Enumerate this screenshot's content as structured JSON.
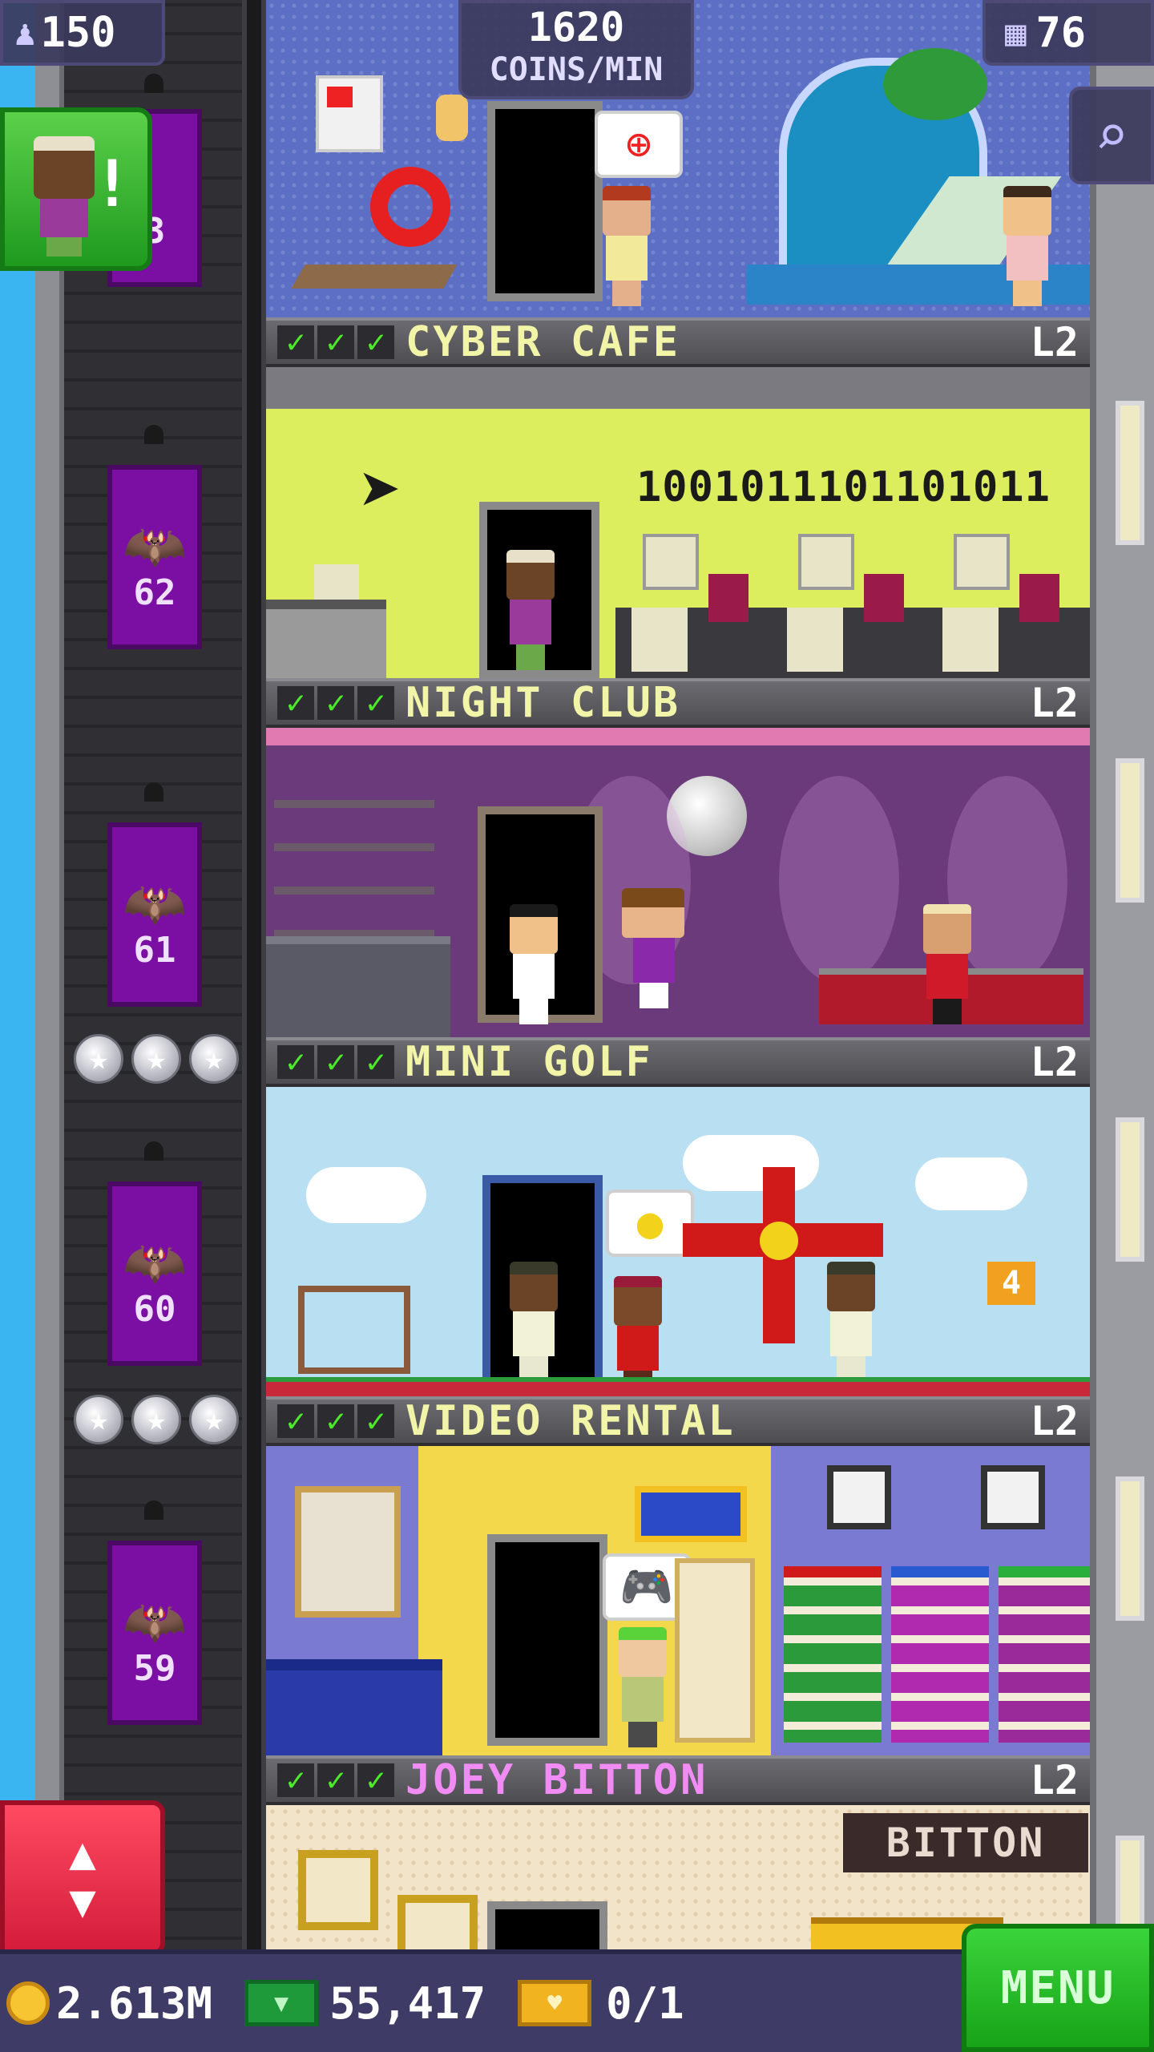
{
  "hud": {
    "population": "150",
    "coins_per_min_value": "1620",
    "coins_per_min_label": "COINS/MIN",
    "floors_count": "76"
  },
  "floors": [
    {
      "name": "CYBER CAFE",
      "level": "L2",
      "sign": "1001011101101011"
    },
    {
      "name": "NIGHT CLUB",
      "level": "L2"
    },
    {
      "name": "MINI GOLF",
      "level": "L2",
      "hole_number": "4"
    },
    {
      "name": "VIDEO RENTAL",
      "level": "L2"
    },
    {
      "name": "JOEY BITTON",
      "level": "L2",
      "sign": "BITTON"
    }
  ],
  "elevator": {
    "floor_numbers": [
      "3",
      "62",
      "61",
      "60",
      "59"
    ]
  },
  "bottom_bar": {
    "coins": "2.613M",
    "bux": "55,417",
    "tickets": "0/1"
  },
  "menu_label": "MENU",
  "colors": {
    "sky": "#3ab5f2",
    "elevator": "#7b0fa3",
    "banner_text": "#f2f4a8",
    "special_floor_text": "#f08cf3",
    "checkmark": "#4cea2a",
    "menu_button": "#17a317",
    "elevator_button": "#d41c3a"
  },
  "icons": [
    "population-icon",
    "floors-icon",
    "search-icon",
    "coin-icon",
    "bux-icon",
    "ticket-icon",
    "bat-icon",
    "star-icon",
    "check-icon",
    "elevator-arrows-icon",
    "exclamation-icon"
  ]
}
